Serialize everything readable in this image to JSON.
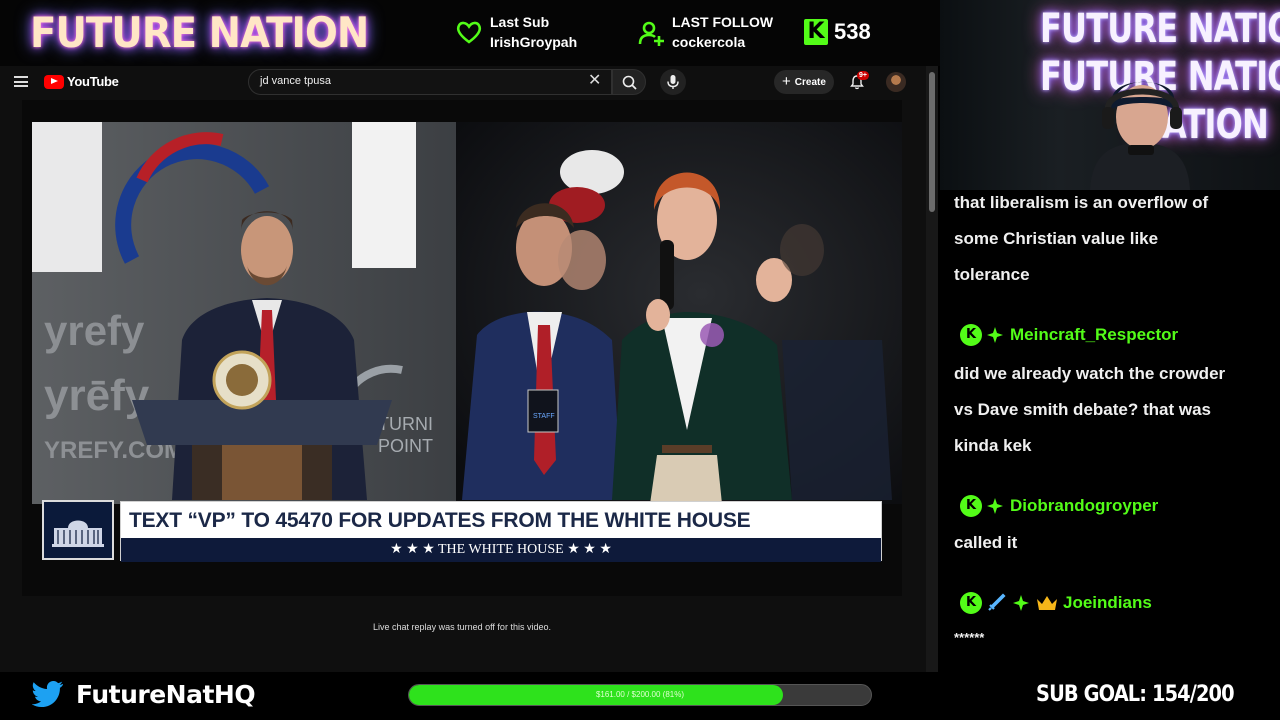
{
  "overlay": {
    "logo": "FUTURE NATION",
    "last_sub": {
      "label": "Last Sub",
      "value": "IrishGroypah"
    },
    "last_follow": {
      "label": "LAST FOLLOW",
      "value": "cockercola"
    },
    "kick": {
      "icon": "kick-logo",
      "count": "538"
    },
    "twitter_handle": "FutureNatHQ",
    "goal_bar": {
      "text": "$161.00 / $200.00 (81%)",
      "progress": 0.81
    },
    "sub_goal": "SUB GOAL: 154/200",
    "colors": {
      "accent_green": "#53fc18",
      "goal_fill": "#2ee21c"
    }
  },
  "youtube": {
    "logo_text": "YouTube",
    "search_value": "jd vance tpusa",
    "create_label": "Create",
    "notification_badge": "9+",
    "live_chat_note": "Live chat replay was turned off for this video."
  },
  "video": {
    "chyron_text": "TEXT “VP” TO 45470 FOR UPDATES FROM THE WHITE HOUSE",
    "chyron_strip": "★ ★ ★   THE WHITE HOUSE   ★ ★ ★",
    "signage_left": [
      "yrefy",
      "yrēfy",
      "YREFY.COM"
    ],
    "signage_right": [
      "TURNI",
      "POINT"
    ],
    "podium_seal": "VICE PRESIDENT OF THE UNITED STATES",
    "badge_text": "STAFF"
  },
  "webcam": {
    "neon_lines": [
      "FUTURE NATION",
      "FUTURE NATION",
      "NATION"
    ]
  },
  "chat": {
    "messages": [
      {
        "user": null,
        "lines": [
          "that liberalism is an overflow of",
          "some Christian value like",
          "tolerance"
        ]
      },
      {
        "user": "Meincraft_Respector",
        "badges": [
          "kick-icon",
          "gem-icon"
        ],
        "lines": [
          "did we already watch the crowder",
          "vs Dave smith debate? that was",
          "kinda kek"
        ]
      },
      {
        "user": "Diobrandogroyper",
        "badges": [
          "kick-icon",
          "gem-icon"
        ],
        "lines": [
          "called it"
        ]
      },
      {
        "user": "Joeindians",
        "badges": [
          "kick-icon",
          "sword-icon",
          "gem-icon",
          "crown-icon"
        ],
        "lines": [
          "******"
        ]
      }
    ]
  }
}
